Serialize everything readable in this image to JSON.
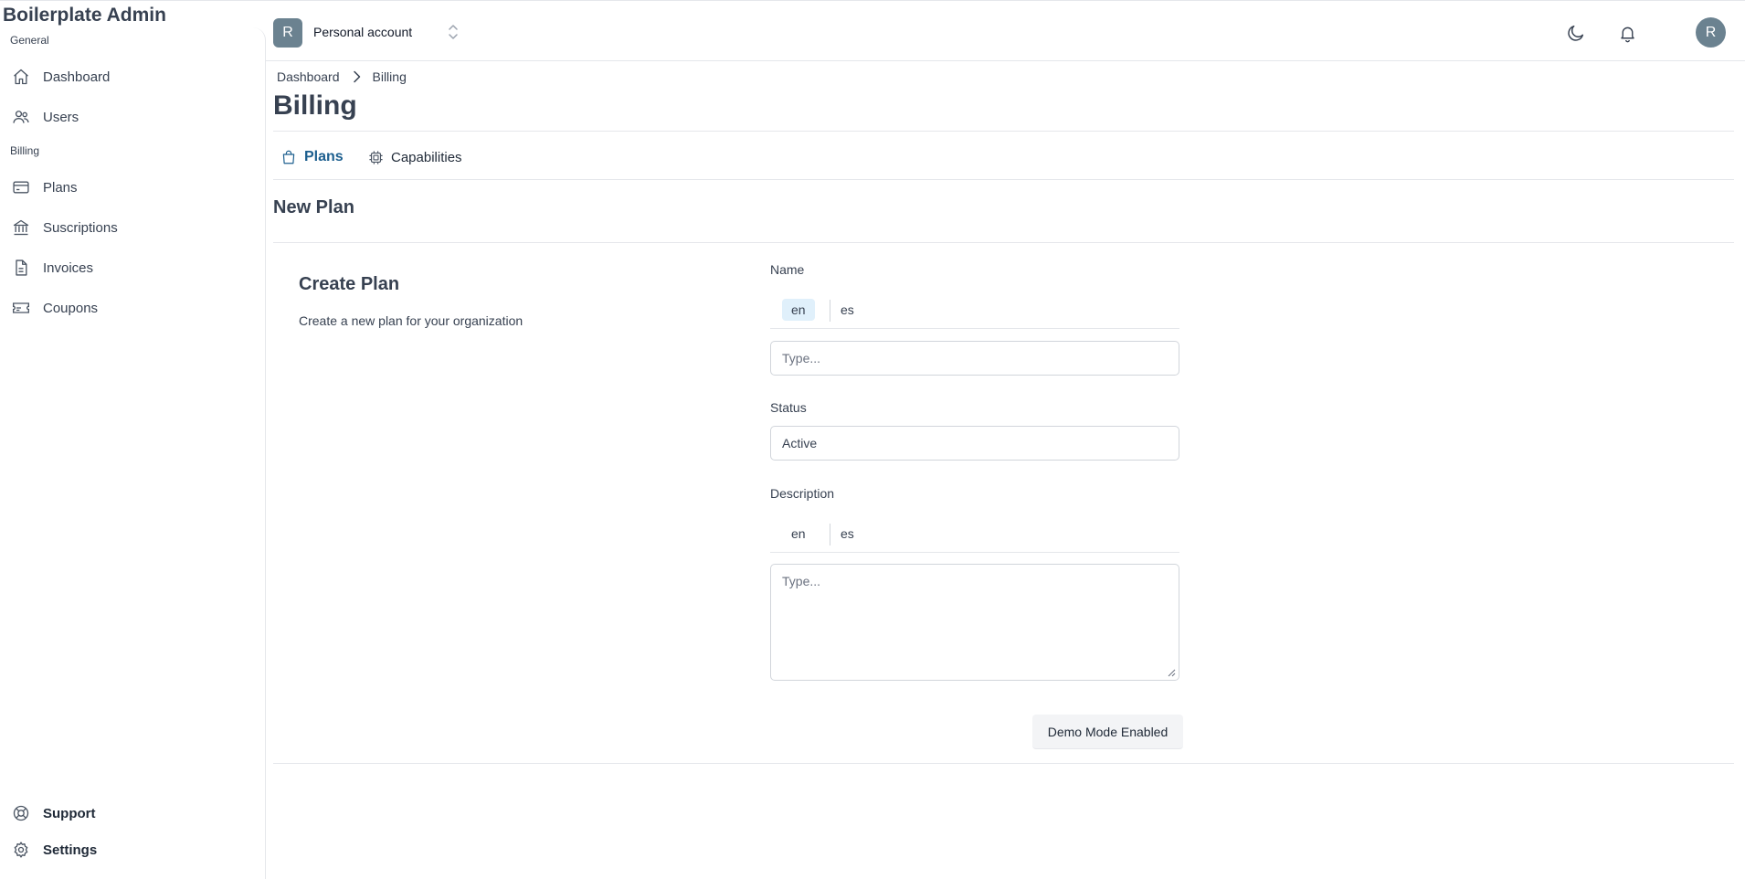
{
  "app": {
    "title": "Boilerplate Admin"
  },
  "sidebar": {
    "sections": [
      {
        "label": "General"
      },
      {
        "label": "Billing"
      }
    ],
    "items": [
      {
        "label": "Dashboard",
        "icon": "home-icon"
      },
      {
        "label": "Users",
        "icon": "users-icon"
      },
      {
        "label": "Plans",
        "icon": "credit-card-icon"
      },
      {
        "label": "Suscriptions",
        "icon": "bank-icon"
      },
      {
        "label": "Invoices",
        "icon": "document-icon"
      },
      {
        "label": "Coupons",
        "icon": "ticket-icon"
      }
    ],
    "footer": [
      {
        "label": "Support",
        "icon": "lifebuoy-icon"
      },
      {
        "label": "Settings",
        "icon": "gear-icon"
      }
    ]
  },
  "header": {
    "account_initial": "R",
    "account_name": "Personal account",
    "user_initial": "R"
  },
  "breadcrumb": [
    "Dashboard",
    "Billing"
  ],
  "page": {
    "title": "Billing"
  },
  "tabs": [
    {
      "label": "Plans",
      "icon": "shopping-bag-icon",
      "active": true
    },
    {
      "label": "Capabilities",
      "icon": "cpu-icon",
      "active": false
    }
  ],
  "section": {
    "title": "New Plan"
  },
  "card": {
    "title": "Create Plan",
    "description": "Create a new plan for your organization"
  },
  "form": {
    "name": {
      "label": "Name",
      "languages": [
        "en",
        "es"
      ],
      "selected_language": "en",
      "placeholder": "Type..."
    },
    "status": {
      "label": "Status",
      "value": "Active"
    },
    "description": {
      "label": "Description",
      "languages": [
        "en",
        "es"
      ],
      "placeholder": "Type..."
    },
    "submit_label": "Demo Mode Enabled"
  },
  "colors": {
    "accent": "#1d5f8f",
    "avatar": "#6b8290",
    "language_highlight": "#e0f0fb"
  }
}
